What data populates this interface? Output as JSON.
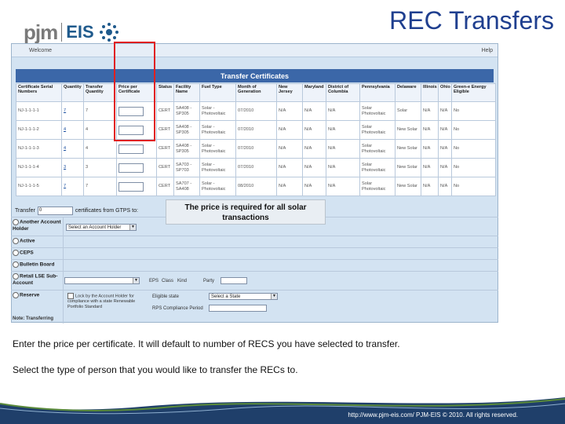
{
  "logo": {
    "pjm": "pjm",
    "eis": "EIS"
  },
  "slide_title": "REC Transfers",
  "app": {
    "welcome": "Welcome",
    "help": "Help",
    "band_title": "Transfer Certificates",
    "columns": [
      "Certificate Serial Numbers",
      "Quantity",
      "Transfer Quantity",
      "Price per Certificate",
      "Status",
      "Facility Name",
      "Fuel Type",
      "Month of Generation",
      "New Jersey",
      "Maryland",
      "District of Columbia",
      "Pennsylvania",
      "Delaware",
      "Illinois",
      "Ohio",
      "Green-e Energy Eligible"
    ],
    "rows": [
      {
        "serial": "NJ-1-1-1-1",
        "qty": "7",
        "tq": "7",
        "status": "CERT",
        "facility": "SA408 - SP305",
        "fuel": "Solar - Photovoltaic",
        "month": "07/2010",
        "nj": "N/A",
        "md": "N/A",
        "dc": "N/A",
        "pa": "Solar Photovoltaic",
        "de": "Solar",
        "il": "N/A",
        "oh": "N/A",
        "green": "No"
      },
      {
        "serial": "NJ-1-1-1-2",
        "qty": "4",
        "tq": "4",
        "status": "CERT",
        "facility": "SA408 - SP305",
        "fuel": "Solar - Photovoltaic",
        "month": "07/2010",
        "nj": "N/A",
        "md": "N/A",
        "dc": "N/A",
        "pa": "Solar Photovoltaic",
        "de": "New Solar",
        "il": "N/A",
        "oh": "N/A",
        "green": "No"
      },
      {
        "serial": "NJ-1-1-1-3",
        "qty": "4",
        "tq": "4",
        "status": "CERT",
        "facility": "SA408 - SP305",
        "fuel": "Solar - Photovoltaic",
        "month": "07/2010",
        "nj": "N/A",
        "md": "N/A",
        "dc": "N/A",
        "pa": "Solar Photovoltaic",
        "de": "New Solar",
        "il": "N/A",
        "oh": "N/A",
        "green": "No"
      },
      {
        "serial": "NJ-1-1-1-4",
        "qty": "3",
        "tq": "3",
        "status": "CERT",
        "facility": "SA703 - SP703",
        "fuel": "Solar - Photovoltaic",
        "month": "07/2010",
        "nj": "N/A",
        "md": "N/A",
        "dc": "N/A",
        "pa": "Solar Photovoltaic",
        "de": "New Solar",
        "il": "N/A",
        "oh": "N/A",
        "green": "No"
      },
      {
        "serial": "NJ-1-1-1-5",
        "qty": "7",
        "tq": "7",
        "status": "CERT",
        "facility": "SA707 - SA408",
        "fuel": "Solar - Photovoltaic",
        "month": "08/2010",
        "nj": "N/A",
        "md": "N/A",
        "dc": "N/A",
        "pa": "Solar Photovoltaic",
        "de": "New Solar",
        "il": "N/A",
        "oh": "N/A",
        "green": "No"
      }
    ],
    "transfer_label": "Transfer",
    "transfer_value": "0",
    "transfer_suffix": "certificates from GTPS to:",
    "options": {
      "another": "Another Account Holder",
      "another_select": "Select an Account Holder",
      "active": "Active",
      "ceps": "CEPS",
      "bulletin": "Bulletin Board",
      "retail": "Retail LSE Sub-Account",
      "retail_labels": [
        "EPS",
        "Class",
        "Kind",
        "Party"
      ],
      "reserve": "Reserve",
      "reserve_check": "Lock by the Account Holder for compliance with a state Renewable Portfolio Standard",
      "reserve_state_label": "Eligible state",
      "reserve_state_select": "Select a State",
      "reserve_period_label": "RPS Compliance Period",
      "note": "Note: Transferring"
    }
  },
  "callout": "The price is required for all solar transactions",
  "captions": [
    "Enter the price per certificate. It will default to number of RECS you have selected to transfer.",
    "Select the type of person that you would like to transfer the RECs to."
  ],
  "footer": "http://www.pjm-eis.com/   PJM-EIS © 2010. All rights reserved."
}
